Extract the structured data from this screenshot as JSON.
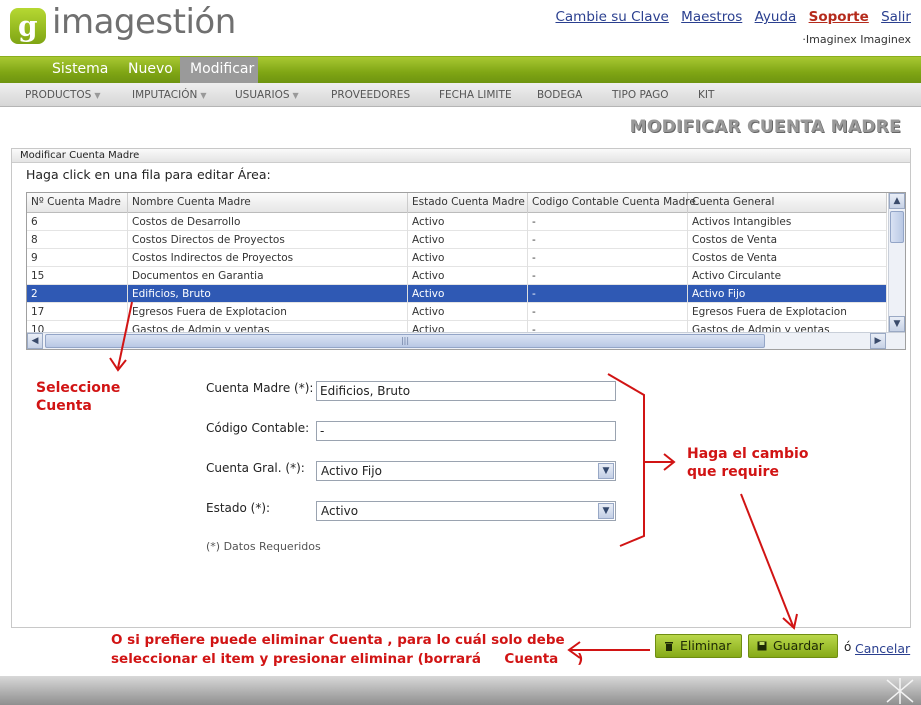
{
  "app": {
    "brand": "imagestión",
    "logo_letter": "g",
    "user_line": "·Imaginex Imaginex"
  },
  "top_links": [
    {
      "label": "Cambie su Clave"
    },
    {
      "label": "Maestros"
    },
    {
      "label": "Ayuda"
    },
    {
      "label": "Soporte"
    },
    {
      "label": "Salir"
    }
  ],
  "main_nav": [
    {
      "label": "Sistema",
      "active": false
    },
    {
      "label": "Nuevo",
      "active": false
    },
    {
      "label": "Modificar",
      "active": true
    }
  ],
  "sub_nav": [
    {
      "label": "PRODUCTOS",
      "dropdown": true
    },
    {
      "label": "IMPUTACIÓN",
      "dropdown": true
    },
    {
      "label": "USUARIOS",
      "dropdown": true
    },
    {
      "label": "PROVEEDORES",
      "dropdown": false
    },
    {
      "label": "FECHA LIMITE",
      "dropdown": false
    },
    {
      "label": "BODEGA",
      "dropdown": false
    },
    {
      "label": "TIPO PAGO",
      "dropdown": false
    },
    {
      "label": "KIT",
      "dropdown": false
    }
  ],
  "page_heading": "MODIFICAR CUENTA MADRE",
  "panel": {
    "title": "Modificar Cuenta Madre",
    "instruction": "Haga click en una fila para editar Área:"
  },
  "grid": {
    "columns": [
      "Nº Cuenta Madre",
      "Nombre Cuenta Madre",
      "Estado Cuenta Madre",
      "Codigo Contable Cuenta Madre",
      "Cuenta General"
    ],
    "rows": [
      [
        "6",
        "Costos de Desarrollo",
        "Activo",
        "-",
        "Activos Intangibles"
      ],
      [
        "8",
        "Costos Directos de Proyectos",
        "Activo",
        "-",
        "Costos de Venta"
      ],
      [
        "9",
        "Costos Indirectos de Proyectos",
        "Activo",
        "-",
        "Costos de Venta"
      ],
      [
        "15",
        "Documentos en Garantia",
        "Activo",
        "-",
        "Activo Circulante"
      ],
      [
        "2",
        "Edificios, Bruto",
        "Activo",
        "-",
        "Activo Fijo"
      ],
      [
        "17",
        "Egresos Fuera de Explotacion",
        "Activo",
        "-",
        "Egresos Fuera de Explotacion"
      ],
      [
        "10",
        "Gastos de Admin y ventas",
        "Activo",
        "-",
        "Gastos de Admin y ventas"
      ]
    ],
    "selected_row": 4,
    "scroll_up": "▲",
    "scroll_down": "▼",
    "scroll_left": "◀",
    "scroll_right": "▶",
    "grip": "|||"
  },
  "form": {
    "cuenta_madre_label": "Cuenta Madre (*):",
    "cuenta_madre_value": "Edificios, Bruto",
    "codigo_label": "Código Contable:",
    "codigo_value": "-",
    "cuenta_gral_label": "Cuenta Gral. (*):",
    "cuenta_gral_value": "Activo Fijo",
    "estado_label": "Estado (*):",
    "estado_value": "Activo",
    "required_note": "(*) Datos Requeridos",
    "dropdown_glyph": "▼"
  },
  "annotations": {
    "select_line1": "Seleccione",
    "select_line2": "Cuenta",
    "change_line1": "Haga el cambio",
    "change_line2": "que require",
    "delete_line1": "O si prefiere puede eliminar Cuenta , para lo cuál solo debe",
    "delete_line2": "seleccionar el item y presionar eliminar (borrará     Cuenta    )"
  },
  "actions": {
    "delete_label": "Eliminar",
    "save_label": "Guardar",
    "or_text": "ó",
    "cancel_label": "Cancelar"
  },
  "colors": {
    "brand_green": "#86aa18",
    "annotation_red": "#d11414",
    "selection_blue": "#2f59b4",
    "link_blue": "#2a3f8f"
  }
}
